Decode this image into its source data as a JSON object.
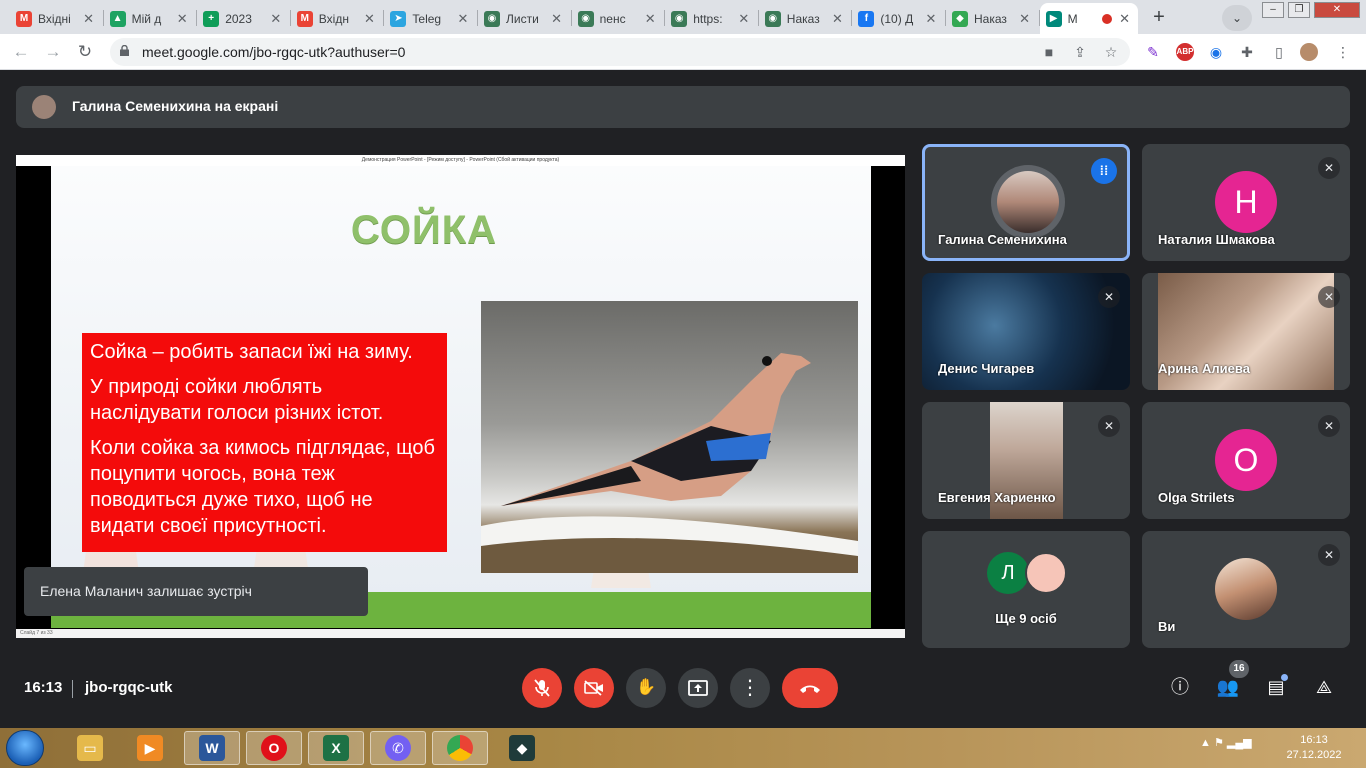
{
  "browser": {
    "tabs": [
      {
        "title": "Вхідні",
        "icon": "gmail-icon",
        "color": "#ea4335",
        "letter": "M"
      },
      {
        "title": "Мій д",
        "icon": "drive-icon",
        "color": "#1ea362",
        "letter": "▲"
      },
      {
        "title": "2023",
        "icon": "sheets-icon",
        "color": "#0f9d58",
        "letter": "+"
      },
      {
        "title": "Вхідн",
        "icon": "gmail-icon",
        "color": "#ea4335",
        "letter": "M"
      },
      {
        "title": "Teleg",
        "icon": "telegram-icon",
        "color": "#2ca5e0",
        "letter": "➤"
      },
      {
        "title": "Листи",
        "icon": "globe-icon",
        "color": "#3b7a57",
        "letter": "◉"
      },
      {
        "title": "nенс",
        "icon": "globe-icon",
        "color": "#3b7a57",
        "letter": "◉"
      },
      {
        "title": "https:",
        "icon": "globe-icon",
        "color": "#3b7a57",
        "letter": "◉"
      },
      {
        "title": "Наказ",
        "icon": "globe-icon",
        "color": "#3b7a57",
        "letter": "◉"
      },
      {
        "title": "(10) Д",
        "icon": "facebook-icon",
        "color": "#1877f2",
        "letter": "f"
      },
      {
        "title": "Наказ",
        "icon": "shield-icon",
        "color": "#34a853",
        "letter": "◆"
      },
      {
        "title": "М",
        "icon": "meet-icon",
        "color": "#00897b",
        "letter": "▶"
      }
    ],
    "url": "meet.google.com/jbo-rgqc-utk?authuser=0"
  },
  "meet": {
    "presenter_banner": "Галина Семенихина на екрані",
    "slide": {
      "window_title": "Демонстрация PowerPoint - [Режим доступу] - PowerPoint (Сбой активации продукта)",
      "title": "СОЙКА",
      "paragraphs": [
        "Сойка – робить запаси їжі на зиму.",
        "У природі сойки люблять наслідувати голоси різних істот.",
        "Коли сойка за кимось підглядає, щоб поцупити чогось, вона теж поводиться дуже тихо, щоб не видати своєї присутності."
      ],
      "status": "Слайд 7 из 33"
    },
    "toast": "Елена Маланич залишає зустріч",
    "participants": [
      {
        "name": "Галина Семенихина",
        "state": "speaking"
      },
      {
        "name": "Наталия Шмакова",
        "letter": "Н",
        "color": "#e52592"
      },
      {
        "name": "Денис Чигарев"
      },
      {
        "name": "Арина Алиева"
      },
      {
        "name": "Евгения Хариенко"
      },
      {
        "name": "Olga Strilets",
        "letter": "O",
        "color": "#e52592"
      },
      {
        "name": "Ще 9 осіб",
        "letters": [
          "Л"
        ]
      },
      {
        "name": "Ви"
      }
    ],
    "clock": "16:13",
    "meeting_code": "jbo-rgqc-utk",
    "people_count": "16"
  },
  "taskbar": {
    "time": "16:13",
    "date": "27.12.2022"
  }
}
